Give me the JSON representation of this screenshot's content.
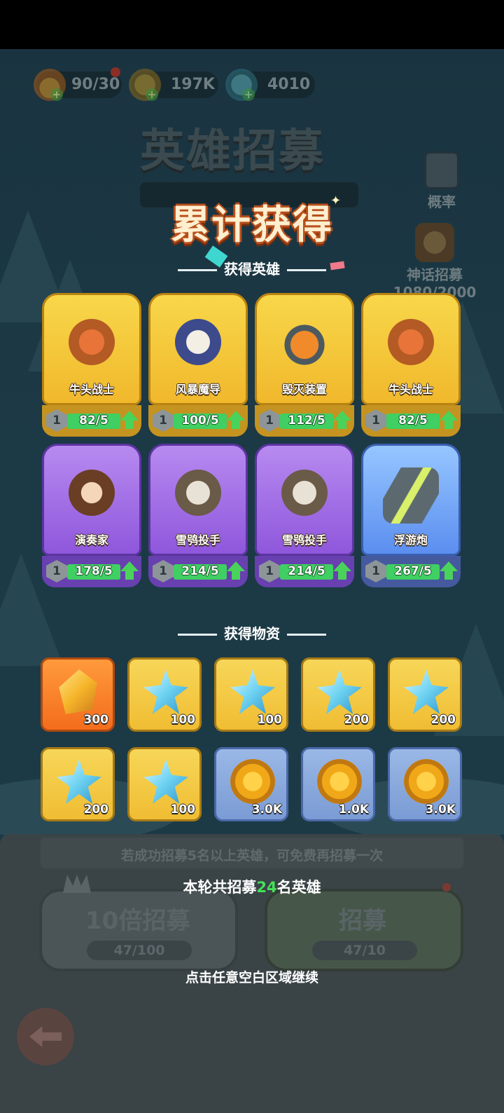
{
  "currencies": [
    {
      "name": "stamina",
      "value": "90/30",
      "color": "#f0a030"
    },
    {
      "name": "gold",
      "value": "197K",
      "color": "#e0b040"
    },
    {
      "name": "crystal",
      "value": "4010",
      "color": "#6ad0e0"
    }
  ],
  "background": {
    "title": "英雄招募",
    "side_buttons": {
      "probability_label": "概率",
      "mythic_label": "神话招募",
      "mythic_progress": "1080/2000"
    },
    "hint": "若成功招募5名以上英雄，可免费再招募一次",
    "ten_pull": {
      "label": "10倍招募",
      "sub": "47/100"
    },
    "single_pull": {
      "label": "招募",
      "sub": "47/10"
    }
  },
  "result": {
    "title": "累计获得",
    "heroes_section": "获得英雄",
    "items_section": "获得物资",
    "summary_prefix": "本轮共招募",
    "summary_count": "24",
    "summary_suffix": "名英雄",
    "continue": "点击任意空白区域继续"
  },
  "heroes": [
    {
      "name": "牛头战士",
      "level": "1",
      "count": "82/5",
      "rarity": "gold",
      "icon": "minotaur-icon"
    },
    {
      "name": "风暴魔导",
      "level": "1",
      "count": "100/5",
      "rarity": "gold",
      "icon": "wizard-icon"
    },
    {
      "name": "毁灭装置",
      "level": "1",
      "count": "112/5",
      "rarity": "gold",
      "icon": "robot-cannon-icon"
    },
    {
      "name": "牛头战士",
      "level": "1",
      "count": "82/5",
      "rarity": "gold",
      "icon": "minotaur-icon"
    },
    {
      "name": "演奏家",
      "level": "1",
      "count": "178/5",
      "rarity": "purple",
      "icon": "bard-icon"
    },
    {
      "name": "雪鸮投手",
      "level": "1",
      "count": "214/5",
      "rarity": "purple",
      "icon": "owl-thrower-icon"
    },
    {
      "name": "雪鸮投手",
      "level": "1",
      "count": "214/5",
      "rarity": "purple",
      "icon": "owl-thrower-icon"
    },
    {
      "name": "浮游炮",
      "level": "1",
      "count": "267/5",
      "rarity": "blue",
      "icon": "floating-cannon-icon"
    }
  ],
  "items": [
    {
      "qty": "300",
      "tier": "orange",
      "icon": "amber-crystal-icon"
    },
    {
      "qty": "100",
      "tier": "gold",
      "icon": "blue-crystal-icon"
    },
    {
      "qty": "100",
      "tier": "gold",
      "icon": "blue-crystal-icon"
    },
    {
      "qty": "200",
      "tier": "gold",
      "icon": "blue-crystal-icon"
    },
    {
      "qty": "200",
      "tier": "gold",
      "icon": "blue-crystal-icon"
    },
    {
      "qty": "200",
      "tier": "gold",
      "icon": "blue-crystal-icon"
    },
    {
      "qty": "100",
      "tier": "gold",
      "icon": "blue-crystal-icon"
    },
    {
      "qty": "3.0K",
      "tier": "blue",
      "icon": "gold-coin-icon"
    },
    {
      "qty": "1.0K",
      "tier": "blue",
      "icon": "gold-coin-icon"
    },
    {
      "qty": "3.0K",
      "tier": "blue",
      "icon": "gold-coin-icon"
    }
  ]
}
